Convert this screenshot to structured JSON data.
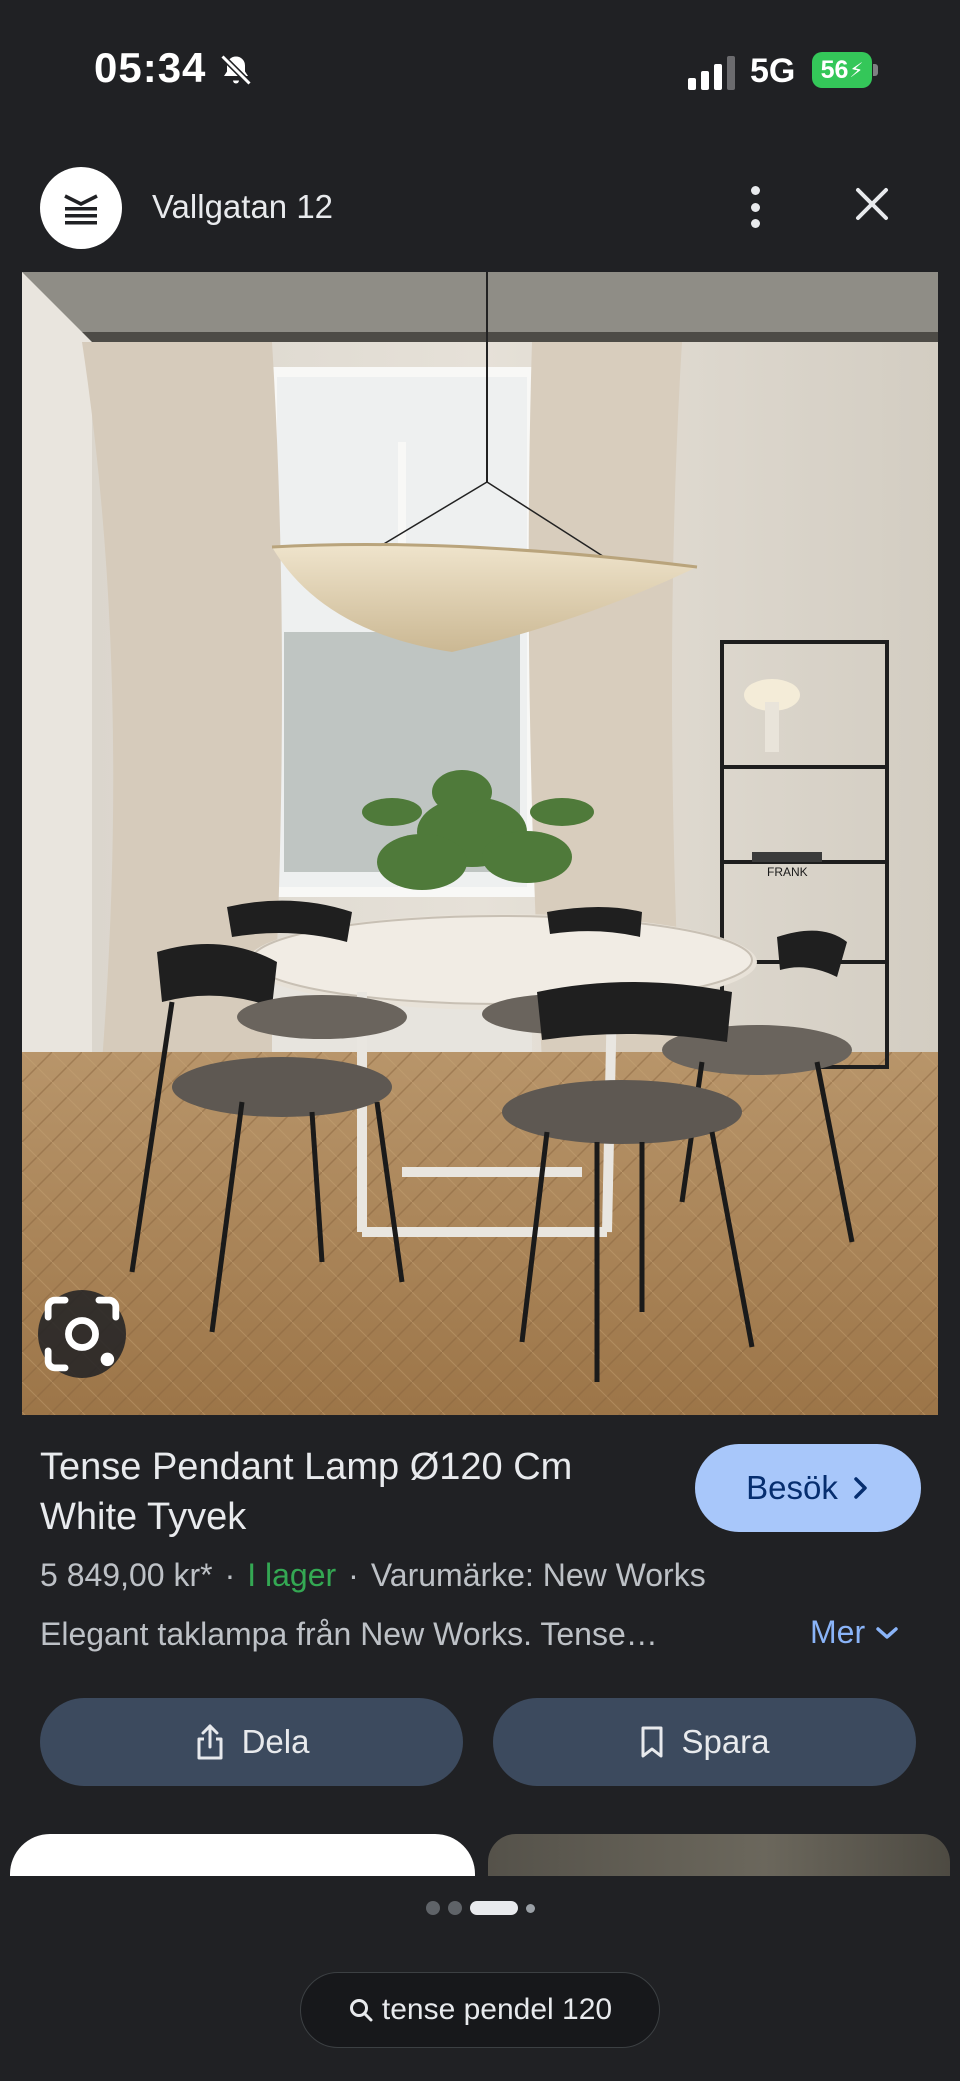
{
  "status_bar": {
    "time": "05:34",
    "network": "5G",
    "battery": "56",
    "icons": [
      "bell-slash-icon",
      "signal-icon",
      "battery-charging-icon"
    ]
  },
  "header": {
    "site_title": "Vallgatan 12",
    "icons": [
      "site-logo-icon",
      "more-vert-icon",
      "close-icon"
    ]
  },
  "image": {
    "alt_icon": "lens-icon",
    "bookshelf_brand": "FRANK"
  },
  "product": {
    "title": "Tense Pendant Lamp Ø120 Cm White Tyvek",
    "visit_label": "Besök",
    "price": "5 849,00 kr*",
    "separator": "·",
    "stock": "I lager",
    "brand": "Varumärke: New Works",
    "description": "Elegant taklampa från New Works. Tense…",
    "more_label": "Mer"
  },
  "actions": {
    "share_label": "Dela",
    "save_label": "Spara"
  },
  "pager": {
    "count": 4,
    "active_index": 2
  },
  "search": {
    "query": "tense pendel 120"
  },
  "colors": {
    "background": "#202124",
    "accent": "#a8c7fa",
    "link": "#8ab4f8",
    "stock": "#34a853",
    "action": "#3c4a5e"
  }
}
